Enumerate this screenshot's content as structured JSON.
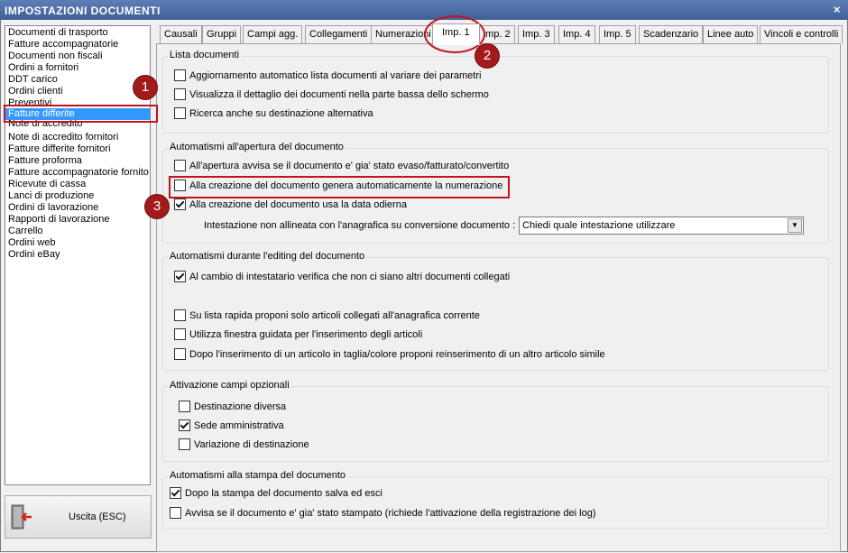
{
  "window": {
    "title": "IMPOSTAZIONI DOCUMENTI",
    "close_glyph": "×"
  },
  "sidebar": {
    "items": [
      "Documenti di trasporto",
      "Fatture accompagnatorie",
      "Documenti non fiscali",
      "Ordini a fornitori",
      "DDT carico",
      "Ordini clienti",
      "Preventivi",
      "Fatture differite",
      "Note di accredito",
      "Note di accredito fornitori",
      "Fatture differite fornitori",
      "Fatture proforma",
      "Fatture accompagnatorie fornito",
      "Ricevute di cassa",
      "Lanci di produzione",
      "Ordini di lavorazione",
      "Rapporti di lavorazione",
      "Carrello",
      "Ordini web",
      "Ordini eBay"
    ],
    "selected": "Fatture differite"
  },
  "exit_button": {
    "label": "Uscita (ESC)",
    "icon": "exit-door-icon"
  },
  "tabs": [
    "Causali",
    "Gruppi",
    "Campi agg.",
    "Collegamenti",
    "Numerazioni",
    "Imp. 1",
    "Imp. 2",
    "Imp. 3",
    "Imp. 4",
    "Imp. 5",
    "Scadenzario",
    "Linee auto",
    "Vincoli e controlli"
  ],
  "active_tab": "Imp. 1",
  "groups": {
    "lista": {
      "title": "Lista documenti",
      "options": [
        {
          "label": "Aggiornamento automatico lista documenti al variare dei parametri",
          "checked": false
        },
        {
          "label": "Visualizza il dettaglio dei documenti nella parte bassa dello schermo",
          "checked": false
        },
        {
          "label": "Ricerca anche su destinazione alternativa",
          "checked": false
        }
      ]
    },
    "apertura": {
      "title": "Automatismi all'apertura del documento",
      "options": [
        {
          "label": "All'apertura avvisa se il documento e' gia' stato evaso/fatturato/convertito",
          "checked": false
        },
        {
          "label": "Alla creazione del documento genera automaticamente la numerazione",
          "checked": false
        },
        {
          "label": "Alla creazione del documento usa la data odierna",
          "checked": true
        }
      ],
      "intestazione_label": "Intestazione non allineata con l'anagrafica su conversione documento :",
      "intestazione_value": "Chiedi quale intestazione utilizzare"
    },
    "editing": {
      "title": "Automatismi durante l'editing del documento",
      "options": [
        {
          "label": "Al cambio di intestatario verifica che non ci siano altri documenti collegati",
          "checked": true
        },
        {
          "label": "Su lista rapida proponi solo articoli collegati all'anagrafica corrente",
          "checked": false
        },
        {
          "label": "Utilizza finestra guidata per l'inserimento degli articoli",
          "checked": false
        },
        {
          "label": "Dopo l'inserimento di un articolo in taglia/colore proponi reinserimento di un altro articolo simile",
          "checked": false
        }
      ]
    },
    "campi": {
      "title": "Attivazione campi opzionali",
      "options": [
        {
          "label": "Destinazione diversa",
          "checked": false
        },
        {
          "label": "Sede amministrativa",
          "checked": true
        },
        {
          "label": "Variazione di destinazione",
          "checked": false
        }
      ]
    },
    "stampa": {
      "title": "Automatismi alla stampa del documento",
      "options": [
        {
          "label": "Dopo la stampa del documento salva ed esci",
          "checked": true
        },
        {
          "label": "Avvisa se il documento e' gia' stato stampato (richiede l'attivazione della registrazione dei log)",
          "checked": false
        }
      ]
    }
  },
  "markers": [
    "1",
    "2",
    "3"
  ],
  "colors": {
    "titlebar": "#4a6ba3",
    "selection": "#3399ff",
    "highlight": "#c4121f",
    "marker": "#a31a1a"
  }
}
